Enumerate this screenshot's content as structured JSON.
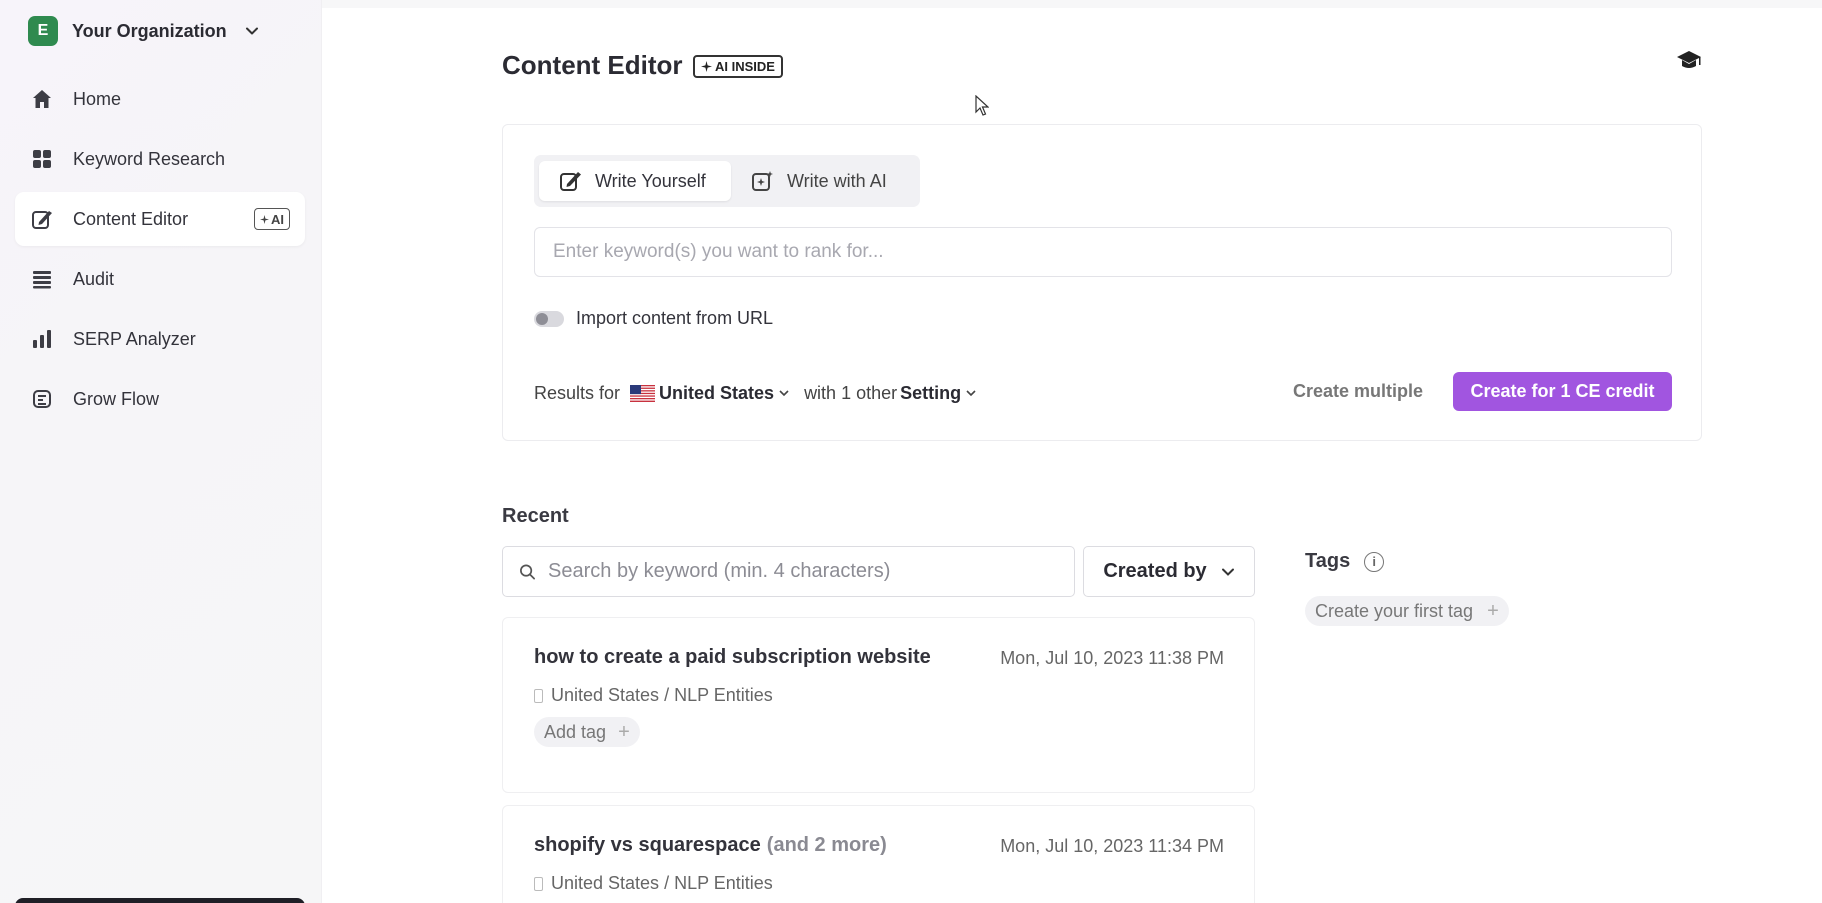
{
  "sidebar": {
    "org": {
      "initial": "E",
      "name": "Your Organization"
    },
    "items": [
      {
        "label": "Home",
        "icon": "home-icon"
      },
      {
        "label": "Keyword Research",
        "icon": "grid-icon"
      },
      {
        "label": "Content Editor",
        "icon": "edit-icon",
        "badge": "AI",
        "active": true
      },
      {
        "label": "Audit",
        "icon": "list-icon"
      },
      {
        "label": "SERP Analyzer",
        "icon": "bar-chart-icon"
      },
      {
        "label": "Grow Flow",
        "icon": "flow-icon"
      }
    ]
  },
  "header": {
    "title": "Content Editor",
    "badge": "AI INSIDE"
  },
  "editor": {
    "mode_write_yourself": "Write Yourself",
    "mode_write_with_ai": "Write with AI",
    "keyword_placeholder": "Enter keyword(s) you want to rank for...",
    "import_label": "Import content from URL",
    "results_for": "Results for",
    "country": "United States",
    "with_other": "with 1 other",
    "setting": "Setting",
    "create_multiple": "Create multiple",
    "create_credit": "Create for 1 CE credit"
  },
  "recent": {
    "title": "Recent",
    "search_placeholder": "Search by keyword (min. 4 characters)",
    "created_by": "Created by",
    "items": [
      {
        "title": "how to create a paid subscription website",
        "more": "",
        "date": "Mon, Jul 10, 2023 11:38 PM",
        "meta": "United States / NLP Entities",
        "tag_label": "Add tag"
      },
      {
        "title": "shopify vs squarespace",
        "more": "(and 2 more)",
        "date": "Mon, Jul 10, 2023 11:34 PM",
        "meta": "United States / NLP Entities"
      }
    ]
  },
  "tags": {
    "title": "Tags",
    "create_first": "Create your first tag"
  },
  "colors": {
    "accent": "#a155e0",
    "org_avatar": "#2f8a4f"
  }
}
